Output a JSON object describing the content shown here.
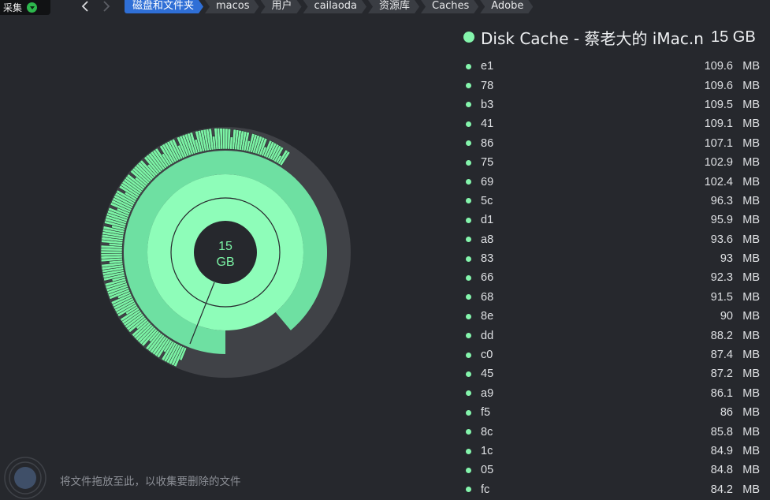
{
  "toolbar": {
    "collect_label": "采集",
    "breadcrumb": [
      "磁盘和文件夹",
      "macos",
      "用户",
      "cailaoda",
      "资源库",
      "Caches",
      "Adobe"
    ]
  },
  "chart": {
    "center_value": "15",
    "center_unit": "GB",
    "colors": {
      "inner": "#8efdb9",
      "middle": "#6ee0a2",
      "outer_files": "#7cf3a5",
      "unused": "#404247",
      "hole": "#26282d"
    }
  },
  "drop_zone": {
    "hint": "将文件拖放至此，以收集要删除的文件"
  },
  "panel": {
    "title": "Disk Cache - 蔡老大的 iMac.n",
    "size": "15 GB",
    "items": [
      {
        "name": "e1",
        "size": "109.6",
        "unit": "MB"
      },
      {
        "name": "78",
        "size": "109.6",
        "unit": "MB"
      },
      {
        "name": "b3",
        "size": "109.5",
        "unit": "MB"
      },
      {
        "name": "41",
        "size": "109.1",
        "unit": "MB"
      },
      {
        "name": "86",
        "size": "107.1",
        "unit": "MB"
      },
      {
        "name": "75",
        "size": "102.9",
        "unit": "MB"
      },
      {
        "name": "69",
        "size": "102.4",
        "unit": "MB"
      },
      {
        "name": "5c",
        "size": "96.3",
        "unit": "MB"
      },
      {
        "name": "d1",
        "size": "95.9",
        "unit": "MB"
      },
      {
        "name": "a8",
        "size": "93.6",
        "unit": "MB"
      },
      {
        "name": "83",
        "size": "93",
        "unit": "MB"
      },
      {
        "name": "66",
        "size": "92.3",
        "unit": "MB"
      },
      {
        "name": "68",
        "size": "91.5",
        "unit": "MB"
      },
      {
        "name": "8e",
        "size": "90",
        "unit": "MB"
      },
      {
        "name": "dd",
        "size": "88.2",
        "unit": "MB"
      },
      {
        "name": "c0",
        "size": "87.4",
        "unit": "MB"
      },
      {
        "name": "45",
        "size": "87.2",
        "unit": "MB"
      },
      {
        "name": "a9",
        "size": "86.1",
        "unit": "MB"
      },
      {
        "name": "f5",
        "size": "86",
        "unit": "MB"
      },
      {
        "name": "8c",
        "size": "85.8",
        "unit": "MB"
      },
      {
        "name": "1c",
        "size": "84.9",
        "unit": "MB"
      },
      {
        "name": "05",
        "size": "84.8",
        "unit": "MB"
      },
      {
        "name": "fc",
        "size": "84.2",
        "unit": "MB"
      }
    ]
  }
}
